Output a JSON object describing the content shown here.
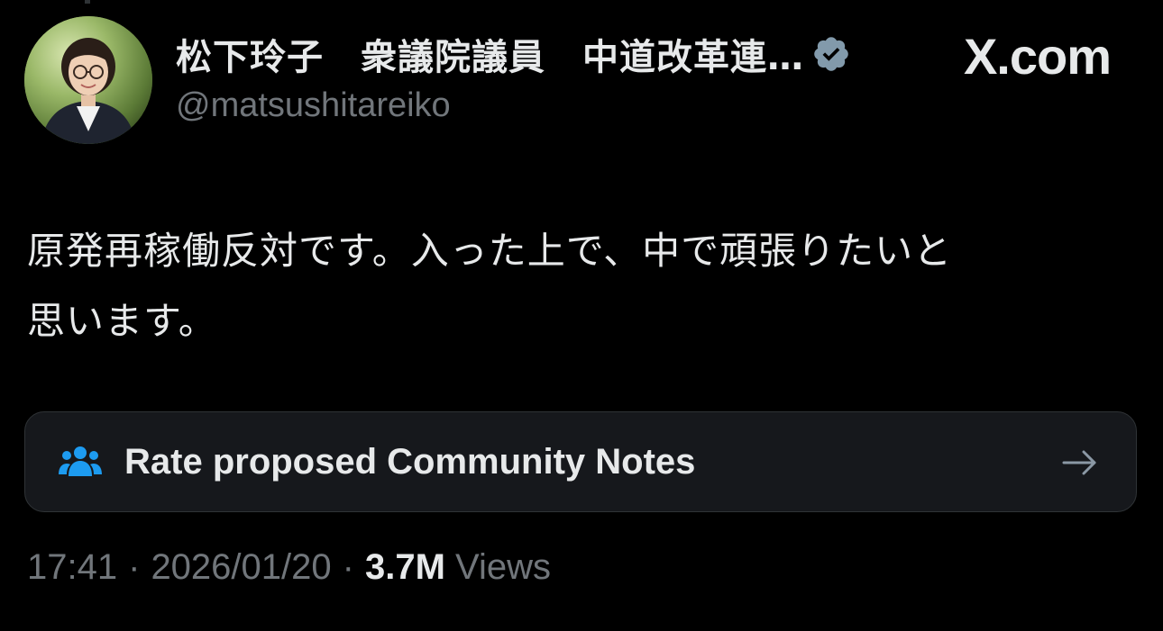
{
  "author": {
    "display_name": "松下玲子　衆議院議員　中道改革連…",
    "handle": "@matsushitareiko",
    "verified": true
  },
  "brand": {
    "logo_text": "X.com"
  },
  "tweet": {
    "text_line1": "原発再稼働反対です。入った上で、中で頑張りたいと",
    "text_line2": "思います。"
  },
  "community_notes": {
    "label": "Rate proposed Community Notes",
    "icon": "people-icon",
    "arrow": "arrow-right-icon"
  },
  "meta": {
    "time": "17:41",
    "date": "2026/01/20",
    "views_count": "3.7M",
    "views_label": "Views",
    "separator": "·"
  },
  "colors": {
    "background": "#000000",
    "text_primary": "#e7e9ea",
    "text_secondary": "#71767b",
    "card_bg": "#16181c",
    "card_border": "#2f3336",
    "accent_blue": "#1d9bf0"
  }
}
